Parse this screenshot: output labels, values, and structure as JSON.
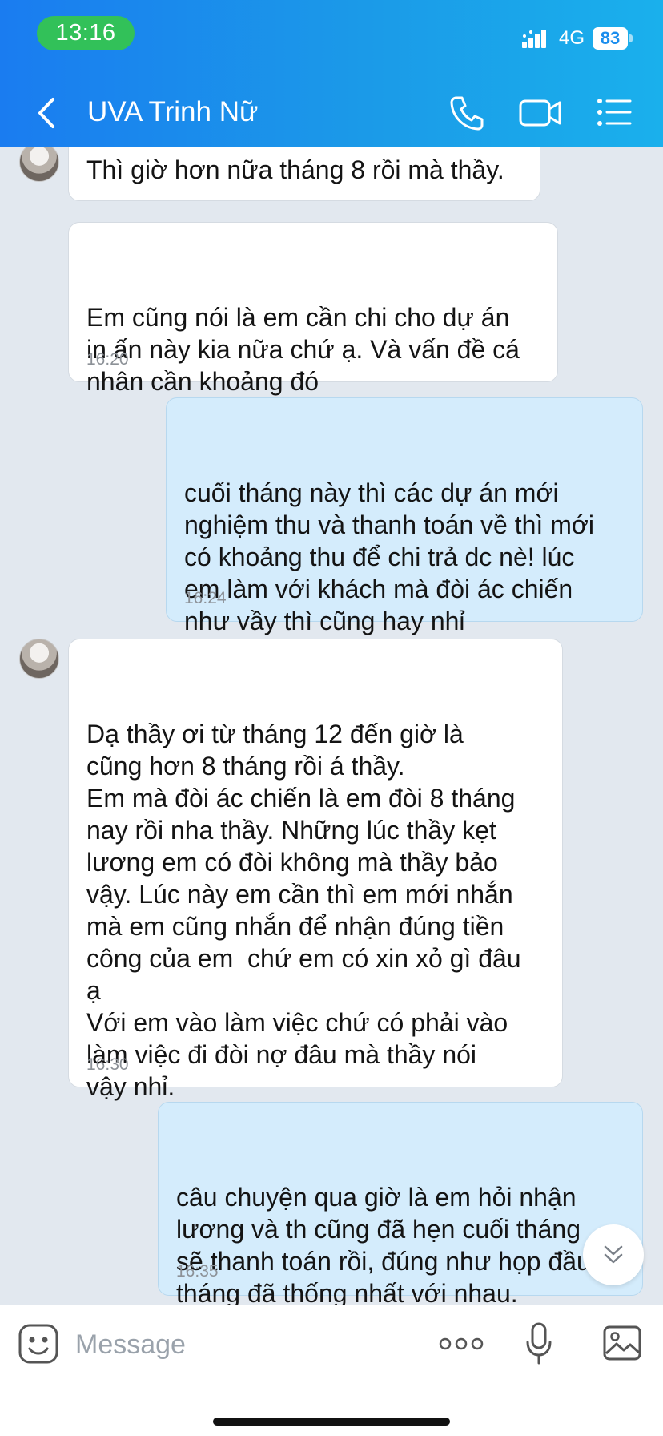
{
  "status_bar": {
    "time": "13:16",
    "network": "4G",
    "battery": "83"
  },
  "header": {
    "title": "UVA Trinh Nữ"
  },
  "messages": [
    {
      "direction": "in",
      "text": "Thì giờ hơn nữa tháng 8 rồi mà thầy.",
      "time": ""
    },
    {
      "direction": "in",
      "text": "Em cũng nói là em cần chi cho dự án\nin ấn này kia nữa chứ ạ. Và vấn đề cá\nnhân cần khoảng đó",
      "time": "16:20"
    },
    {
      "direction": "out",
      "text": "cuối tháng này thì các dự án mới\nnghiệm thu và thanh toán về thì mới\ncó khoảng thu để chi trả dc nè! lúc\nem làm với khách mà đòi ác chiến\nnhư vầy thì cũng hay nhỉ",
      "time": "16:24"
    },
    {
      "direction": "in",
      "text": "Dạ thầy ơi từ tháng 12 đến giờ là\ncũng hơn 8 tháng rồi á thầy.\nEm mà đòi ác chiến là em đòi 8 tháng\nnay rồi nha thầy. Những lúc thầy kẹt\nlương em có đòi không mà thầy bảo\nvậy. Lúc này em cần thì em mới nhắn\nmà em cũng nhắn để nhận đúng tiền\ncông của em  chứ em có xin xỏ gì đâu\nạ\nVới em vào làm việc chứ có phải vào\nlàm việc đi đòi nợ đâu mà thầy nói\nvậy nhỉ.",
      "time": "16:30"
    },
    {
      "direction": "out",
      "text": "câu chuyện qua giờ là em hỏi nhận\nlương và th cũng đã hẹn cuối tháng\nsẽ thanh toán rồi, đúng như họp đầu\ntháng đã thống nhất với nhau.",
      "time": "16:35"
    }
  ],
  "composer": {
    "placeholder": "Message"
  },
  "colors": {
    "header_start": "#1a7cf0",
    "header_end": "#1ab0ec",
    "outgoing_bubble": "#d4ecfc",
    "incoming_bubble": "#ffffff",
    "chat_background": "#e2e8ef"
  }
}
